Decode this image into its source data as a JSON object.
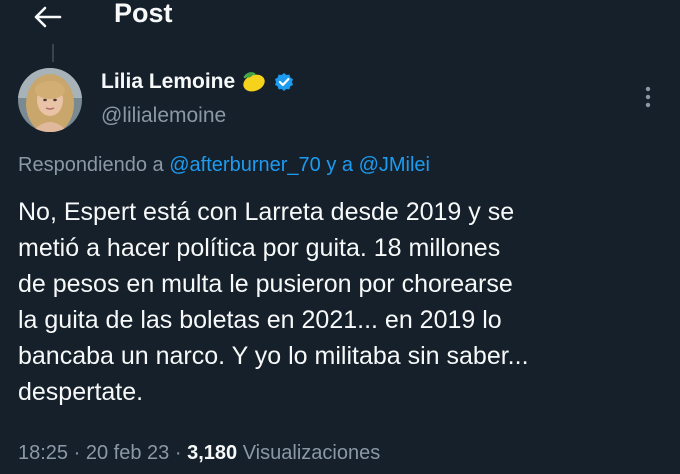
{
  "header": {
    "title": "Post",
    "back_icon": "arrow-left-icon"
  },
  "tweet": {
    "author": {
      "name": "Lilia Lemoine",
      "handle": "@lilialemoine",
      "emoji_icon": "lemon-icon",
      "verified_icon": "verified-badge-icon",
      "verified_color": "#1d9bf0"
    },
    "replying": {
      "prefix": "Respondiendo a",
      "mention1": "@afterburner_70",
      "connector": "y a",
      "mention2": "@JMilei"
    },
    "text_lines": [
      "No, Espert está con Larreta desde 2019 y se",
      "metió a hacer política por guita. 18 millones",
      "de pesos en multa le pusieron por chorearse",
      "la guita de las boletas en 2021... en 2019 lo",
      "bancaba un narco. Y yo lo militaba sin saber...",
      "despertate."
    ],
    "time": "18:25",
    "date": "20 feb 23",
    "separator": "·",
    "views_count": "3,180",
    "views_label": "Visualizaciones"
  },
  "colors": {
    "background": "#15202b",
    "text": "#f7f9f9",
    "secondary_text": "#8b98a5",
    "accent": "#1d9bf0"
  }
}
